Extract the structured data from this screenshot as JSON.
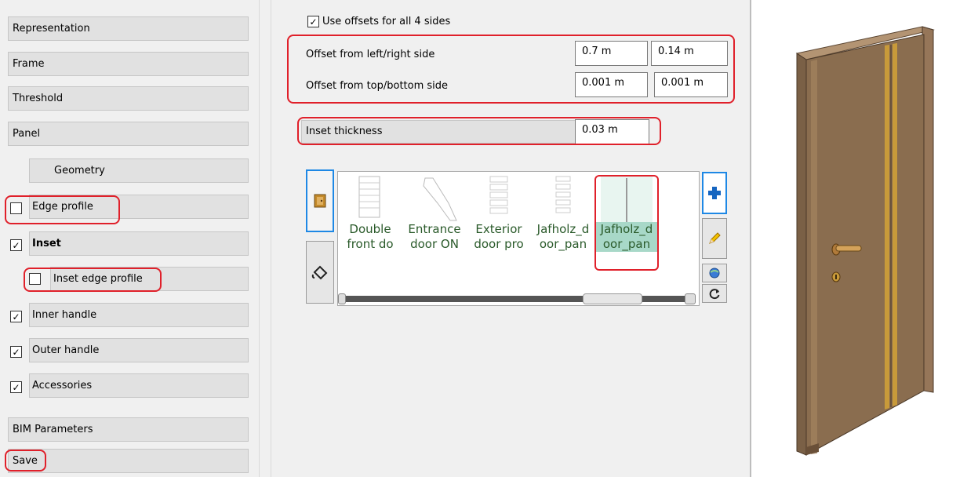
{
  "left_nav": {
    "representation": "Representation",
    "frame": "Frame",
    "threshold": "Threshold",
    "panel": "Panel",
    "geometry": "Geometry",
    "edge_profile": "Edge profile",
    "inset": "Inset",
    "inset_edge_profile": "Inset edge profile",
    "inner_handle": "Inner handle",
    "outer_handle": "Outer handle",
    "accessories": "Accessories",
    "bim_parameters": "BIM Parameters",
    "save": "Save"
  },
  "checks": {
    "edge_profile": false,
    "inset": true,
    "inset_edge_profile": false,
    "inner_handle": true,
    "outer_handle": true,
    "accessories": true,
    "use_offsets": true
  },
  "offsets": {
    "use_offsets_label": "Use offsets for all 4 sides",
    "left_right_label": "Offset from left/right side",
    "left_value": "0.7 m",
    "right_value": "0.14 m",
    "top_bottom_label": "Offset from top/bottom side",
    "top_value": "0.001 m",
    "bottom_value": "0.001 m"
  },
  "inset": {
    "thickness_label": "Inset thickness",
    "thickness_value": "0.03 m"
  },
  "gallery": {
    "items": [
      {
        "line1": "Double",
        "line2": "front do"
      },
      {
        "line1": "Entrance",
        "line2": "door ON"
      },
      {
        "line1": "Exterior",
        "line2": "door pro"
      },
      {
        "line1": "Jafholz_d",
        "line2": "oor_pan"
      },
      {
        "line1": "Jafholz_d",
        "line2": "oor_pan"
      }
    ],
    "selected_index": 4
  },
  "colors": {
    "highlight": "#e0202a",
    "selection": "#a8d8c8",
    "door_wood": "#8a6d4f"
  }
}
